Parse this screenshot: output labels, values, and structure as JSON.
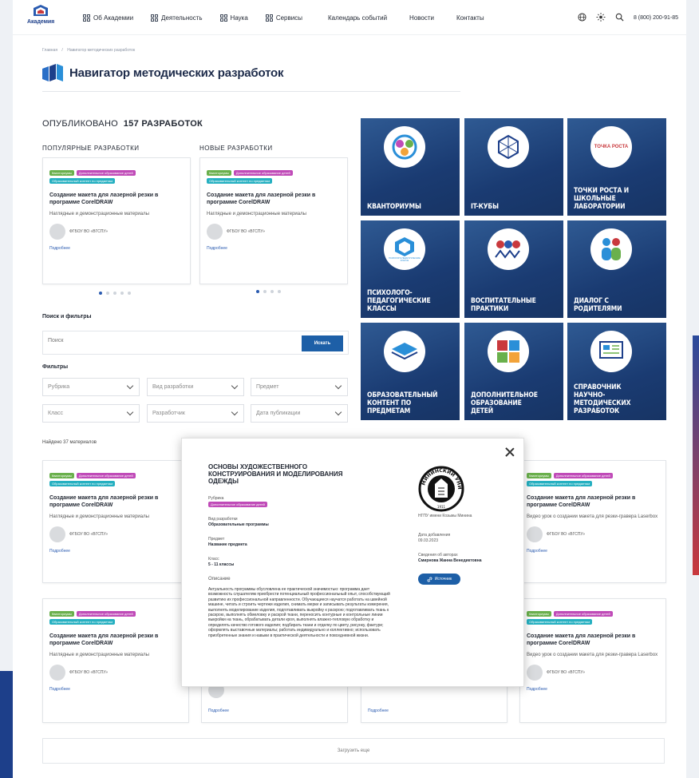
{
  "header": {
    "logo_text": "Академия",
    "nav": [
      "Об Академии",
      "Деятельность",
      "Наука",
      "Сервисы",
      "Календарь событий",
      "Новости",
      "Контакты"
    ],
    "phone": "8 (800) 200-91-85"
  },
  "breadcrumb": {
    "home": "Главная",
    "sep": "/",
    "current": "Навигатор методических разработок"
  },
  "page_title": "Навигатор методических разработок",
  "published": {
    "prefix": "ОПУБЛИКОВАНО",
    "count": "157 РАЗРАБОТОК"
  },
  "popular": {
    "label": "ПОПУЛЯРНЫЕ РАЗРАБОТКИ",
    "card": {
      "tags": [
        "Кванториумы",
        "Дополнительное образование детей",
        "Образовательный контент по предметам"
      ],
      "title": "Создание макета для лазерной резки в программе CorelDRAW",
      "desc": "Наглядные и демонстрационные материалы",
      "org": "ФГБОУ ВО «ВГСПУ»",
      "more": "Подробнее"
    }
  },
  "new": {
    "label": "НОВЫЕ РАЗРАБОТКИ",
    "card": {
      "tags": [
        "Кванториумы",
        "Дополнительное образование детей",
        "Образовательный контент по предметам"
      ],
      "title": "Создание макета для лазерной резки в программе CorelDRAW",
      "desc": "Наглядные и демонстрационные материалы",
      "org": "ФГБОУ ВО «ВГСПУ»",
      "more": "Подробнее"
    }
  },
  "search": {
    "heading": "Поиск и фильтры",
    "placeholder": "Поиск",
    "button": "Искать"
  },
  "filters": {
    "heading": "Фильтры",
    "items": [
      "Рубрика",
      "Вид разработки",
      "Предмет",
      "Класс",
      "Разработчик",
      "Дата публикации"
    ]
  },
  "tiles": [
    "Кванториумы",
    "IT-кубы",
    "Точки роста и школьные лаборатории",
    "Психолого-педагогические классы",
    "Воспитательные практики",
    "Диалог с родителями",
    "Образовательный контент по предметам",
    "Дополнительное образование детей",
    "Справочник научно-методических разработок"
  ],
  "tile_logos": {
    "tochka": "ТОЧКА РОСТА",
    "ppk": "ПСИХОЛОГО-ПЕДАГОГИЧЕСКИЕ КЛАССЫ"
  },
  "found": "Найдено 37 материалов",
  "results": {
    "tags_a": [
      "Кванториумы",
      "Дополнительное образование детей",
      "Образовательный контент по предметам"
    ],
    "tags_b": [
      "Кванториумы",
      "Дополнительное образование детей",
      "Образовательный контент по предметам"
    ],
    "title_a": "Создание макета для лазерной резки в программе CorelDRAW",
    "desc_a": "Наглядные и демонстрационные материалы",
    "title_b": "Создание макета для лазерной резки в программе CorelDRAW",
    "desc_b": "Видео урок о создании макета для резки-гравера Laserbox",
    "org": "ФГБОУ ВО «ВГСПУ»",
    "more": "Подробнее"
  },
  "load_more": "Загрузить еще",
  "modal": {
    "title": "ОСНОВЫ ХУДОЖЕСТВЕННОГО КОНСТРУИРОВАНИЯ И МОДЕЛИРОВАНИЯ ОДЕЖДЫ",
    "rubric_label": "Рубрика",
    "rubric_tag": "Дополнительное образование детей",
    "type_label": "Вид разработки",
    "type_value": "Образовательные программы",
    "subject_label": "Предмет",
    "subject_value": "Название предмета",
    "class_label": "Класс",
    "class_value": "5 - 11 классы",
    "desc_label": "Описание",
    "desc": "Актуальность программы обусловлена ее практической значимостью: программа дает возможность слушателям приобрести потенциальный профессиональный опыт, способствующий развитию их профессиональной направленности. Обучающиеся научатся работать на швейной машине, читать и строить чертежи изделия, снимать мерки и записывать результаты измерения, выполнять моделирование изделия, подготавливать выкройку к раскрою; подготавливать ткань к раскрою, выполнять обмеловку и раскрой ткани, переносить контурные и контрольные линии выкройки на ткань, обрабатывать детали кроя, выполнять влажно-тепловую обработку и определять качество готового изделия; подбирать ткани и отделку по цвету, рисунку, фактуре; оформлять выставочные материалы; работать индивидуально и коллективно; использовать приобретенные знания и навыки в практической деятельности и повседневной жизни.",
    "seal_text": "МИНИНСКИЙ УНИВЕРСИТЕТ",
    "seal_year": "1911",
    "org_name": "НГПУ имени Козьмы Минина",
    "date_label": "Дата добавления",
    "date_value": "09.03.2023",
    "author_label": "Сведения об авторах",
    "author_value": "Смирнова Жанна Венедиктовна",
    "source_button": "Источник"
  },
  "colors": {
    "brand": "#1d5fa7",
    "tile": "#1d3f78",
    "tag_green": "#6ab04c",
    "tag_purple": "#c04bb8",
    "tag_teal": "#26b0c1"
  }
}
